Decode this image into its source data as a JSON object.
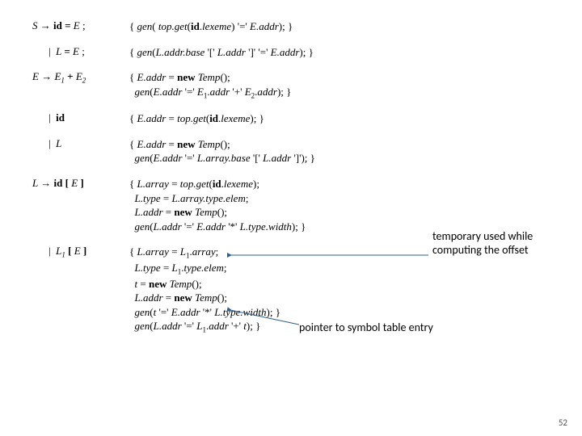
{
  "productions": {
    "p1": {
      "lhs": "S → id = E ;",
      "sem": "{ gen( top.get(id.lexeme) '=' E.addr); }"
    },
    "p2": {
      "lhs": "| L = E ;",
      "sem": "{ gen(L.addr.base '[' L.addr ']' '=' E.addr); }"
    },
    "p3": {
      "lhs": "E → E₁ + E₂",
      "sem1": "{ E.addr = new Temp ();",
      "sem2": "  gen(E.addr '=' E₁.addr '+' E₂.addr); }"
    },
    "p4": {
      "lhs": "| id",
      "sem": "{ E.addr = top.get(id.lexeme); }"
    },
    "p5": {
      "lhs": "| L",
      "sem1": "{ E.addr = new Temp ();",
      "sem2": "  gen(E.addr '=' L.array.base '[' L.addr ']'); }"
    },
    "p6": {
      "lhs": "L → id [ E ]",
      "sem1": "{ L.array = top.get(id.lexeme);",
      "sem2": "  L.type = L.array.type.elem;",
      "sem3": "  L.addr = new Temp ();",
      "sem4": "  gen(L.addr '=' E.addr '*' L.type.width); }"
    },
    "p7": {
      "lhs": "| L₁ [ E ]",
      "sem1": "{ L.array = L₁.array;",
      "sem2": "  L.type = L₁.type.elem;",
      "sem3": "  t = new Temp ();",
      "sem4": "  L.addr = new Temp ();",
      "sem5": "  gen(t '=' E.addr '*' L.type.width); }",
      "sem6": "  gen(L.addr '=' L₁.addr '+' t); }"
    }
  },
  "annotations": {
    "temp_offset": "temporary used while computing the offset",
    "symtab_ptr": "pointer to symbol table entry"
  },
  "page_number": "52"
}
